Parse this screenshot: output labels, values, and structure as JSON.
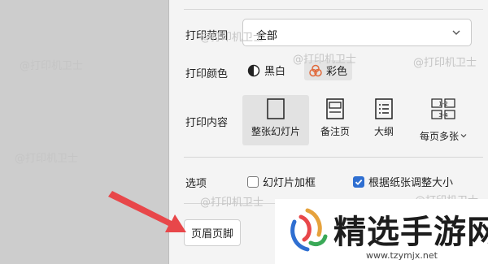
{
  "panel": {
    "range": {
      "label": "打印范围",
      "value": "全部"
    },
    "color": {
      "label": "打印颜色",
      "options": [
        "黑白",
        "彩色"
      ],
      "selected": "彩色"
    },
    "content": {
      "label": "打印内容",
      "tiles": [
        "整张幻灯片",
        "备注页",
        "大纲",
        "每页多张"
      ],
      "selected": "整张幻灯片",
      "multi_icon_labels": [
        "1-2",
        "3-4"
      ]
    },
    "options": {
      "label": "选项",
      "frame": {
        "label": "幻灯片加框",
        "checked": false
      },
      "fit": {
        "label": "根据纸张调整大小",
        "checked": true
      }
    },
    "header_footer_button": "页眉页脚"
  },
  "watermark": {
    "text": "@打印机卫士"
  },
  "brand": {
    "name": "精选手游网",
    "url": "www.tzymjx.net"
  },
  "colors": {
    "accent": "#2f6fd1",
    "arrow": "#e8474a",
    "panel_bg": "#f4f4f4"
  }
}
